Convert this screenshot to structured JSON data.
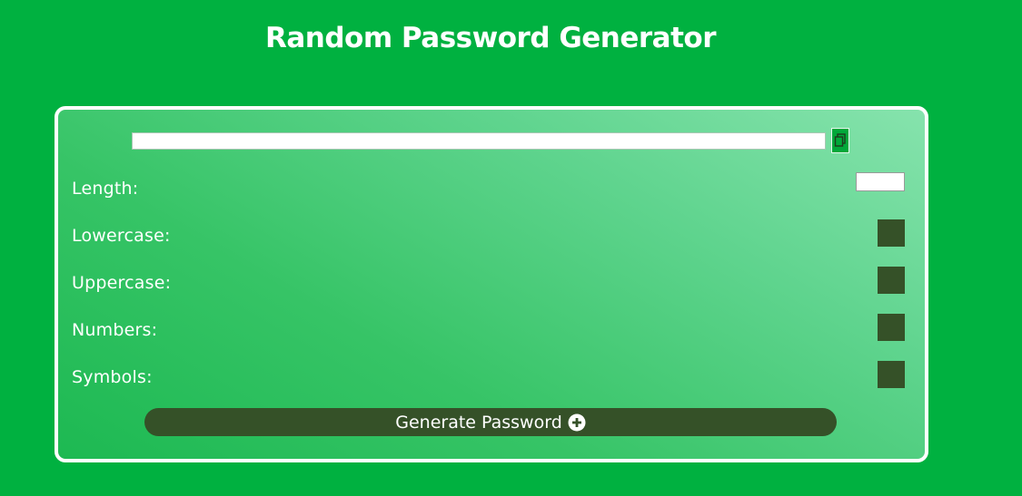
{
  "page": {
    "title": "Random Password Generator"
  },
  "password": {
    "value": "",
    "copy_icon": "clipboard-icon"
  },
  "options": {
    "length_label": "Length:",
    "length_value": "",
    "lowercase_label": "Lowercase:",
    "uppercase_label": "Uppercase:",
    "numbers_label": "Numbers:",
    "symbols_label": "Symbols:"
  },
  "generate": {
    "label": "Generate Password",
    "icon": "plus-circle-icon"
  },
  "colors": {
    "background": "#00b140",
    "checkbox": "#355128",
    "button": "#355128",
    "copy_button": "#00a83a"
  }
}
